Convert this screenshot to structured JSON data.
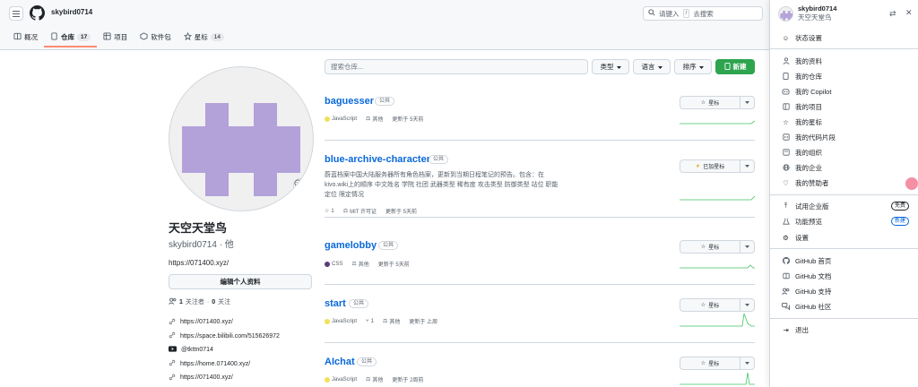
{
  "header": {
    "owner": "skybird0714",
    "search_placeholder": "请键入",
    "search_key": "/",
    "search_suffix": "去搜索"
  },
  "tabs": [
    {
      "label": "概况",
      "count": ""
    },
    {
      "label": "仓库",
      "count": "17"
    },
    {
      "label": "项目",
      "count": ""
    },
    {
      "label": "软件包",
      "count": ""
    },
    {
      "label": "星标",
      "count": "14"
    }
  ],
  "profile": {
    "name": "天空天堂鸟",
    "login": "skybird0714 · 他",
    "bio": "https://071400.xyz/",
    "edit_label": "编辑个人资料",
    "followers_count": "1",
    "followers_label": "关注者",
    "following_sep": "·",
    "following_count": "0",
    "following_label": "关注",
    "links": [
      "https://071400.xyz/",
      "https://space.bilibili.com/515626972",
      "@tkttn0714",
      "https://home.071400.xyz/",
      "https://071400.xyz/"
    ],
    "avatar_color": "#b3a1d9"
  },
  "filter": {
    "search_placeholder": "搜索仓库...",
    "type_label": "类型",
    "language_label": "语言",
    "sort_label": "排序",
    "new_label": "新建"
  },
  "repos": [
    {
      "name": "baguesser",
      "visibility": "公共",
      "description": "",
      "language": "JavaScript",
      "lang_color": "#f1e05a",
      "stars": "",
      "forks": "",
      "license": "其他",
      "updated": "更新于 5天前",
      "star_label": "星标"
    },
    {
      "name": "blue-archive-character",
      "visibility": "公共",
      "description": "蔚蓝档案中国大陆服务器所有角色档案，更新到当期日程笔记的预告。包含：在kivo.wiki上的顺序 中文姓名 学院 社团 武器类型 稀有度 攻击类型 防御类型 站位 职能定位 限定情况",
      "language": "",
      "lang_color": "",
      "stars": "1",
      "forks": "",
      "license": "MIT 许可证",
      "updated": "更新于 5天前",
      "star_label": "已加星标"
    },
    {
      "name": "gamelobby",
      "visibility": "公共",
      "description": "",
      "language": "CSS",
      "lang_color": "#563d7c",
      "stars": "",
      "forks": "",
      "license": "其他",
      "updated": "更新于 5天前",
      "star_label": "星标"
    },
    {
      "name": "start",
      "visibility": "公共",
      "description": "",
      "language": "JavaScript",
      "lang_color": "#f1e05a",
      "stars": "",
      "forks": "1",
      "license": "其他",
      "updated": "更新于 上周",
      "star_label": "星标"
    },
    {
      "name": "AIchat",
      "visibility": "公共",
      "description": "",
      "language": "JavaScript",
      "lang_color": "#f1e05a",
      "stars": "",
      "forks": "",
      "license": "其他",
      "updated": "更新于 2周前",
      "star_label": "星标"
    }
  ],
  "menu": {
    "login": "skybird0714",
    "name": "天空天堂鸟",
    "status": "状态设置",
    "group1": [
      "我的资料",
      "我的仓库",
      "我的 Copilot",
      "我的项目",
      "我的星标",
      "我的代码片段",
      "我的组织",
      "我的企业",
      "我的赞助者"
    ],
    "group2": [
      {
        "label": "试用企业版",
        "badge": "免费"
      },
      {
        "label": "功能预览",
        "badge": "新建"
      },
      {
        "label": "设置",
        "badge": ""
      }
    ],
    "group3": [
      "GitHub 首页",
      "GitHub 文档",
      "GitHub 支持",
      "GitHub 社区"
    ],
    "logout": "退出"
  },
  "colors": {
    "accent_green": "#2da44e",
    "link_blue": "#0969da",
    "tab_underline": "#fd8c73"
  }
}
